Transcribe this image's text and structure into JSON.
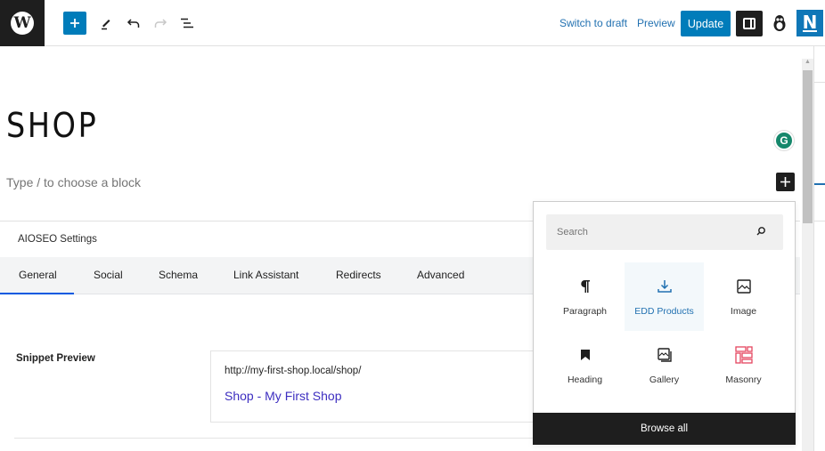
{
  "topbar": {
    "logo": "W",
    "switch_to_draft": "Switch to draft",
    "preview": "Preview",
    "update": "Update",
    "n_logo": "N"
  },
  "editor": {
    "title": "SHOP",
    "placeholder": "Type / to choose a block",
    "grammarly": "G"
  },
  "aioseo": {
    "title": "AIOSEO Settings",
    "tabs": [
      "General",
      "Social",
      "Schema",
      "Link Assistant",
      "Redirects",
      "Advanced"
    ],
    "active_tab": "General",
    "snippet_label": "Snippet Preview",
    "snippet_url": "http://my-first-shop.local/shop/",
    "snippet_title": "Shop - My First Shop"
  },
  "inserter": {
    "search_placeholder": "Search",
    "blocks": [
      {
        "label": "Paragraph",
        "icon": "paragraph-icon"
      },
      {
        "label": "EDD Products",
        "icon": "download-icon",
        "highlighted": true
      },
      {
        "label": "Image",
        "icon": "image-icon"
      },
      {
        "label": "Heading",
        "icon": "bookmark-icon"
      },
      {
        "label": "Gallery",
        "icon": "gallery-icon"
      },
      {
        "label": "Masonry",
        "icon": "masonry-icon"
      }
    ],
    "browse_all": "Browse all"
  },
  "colors": {
    "accent": "#007cba",
    "dark": "#1e1e1e",
    "masonry": "#e5455f",
    "snippet_title": "#3d2ec0"
  }
}
